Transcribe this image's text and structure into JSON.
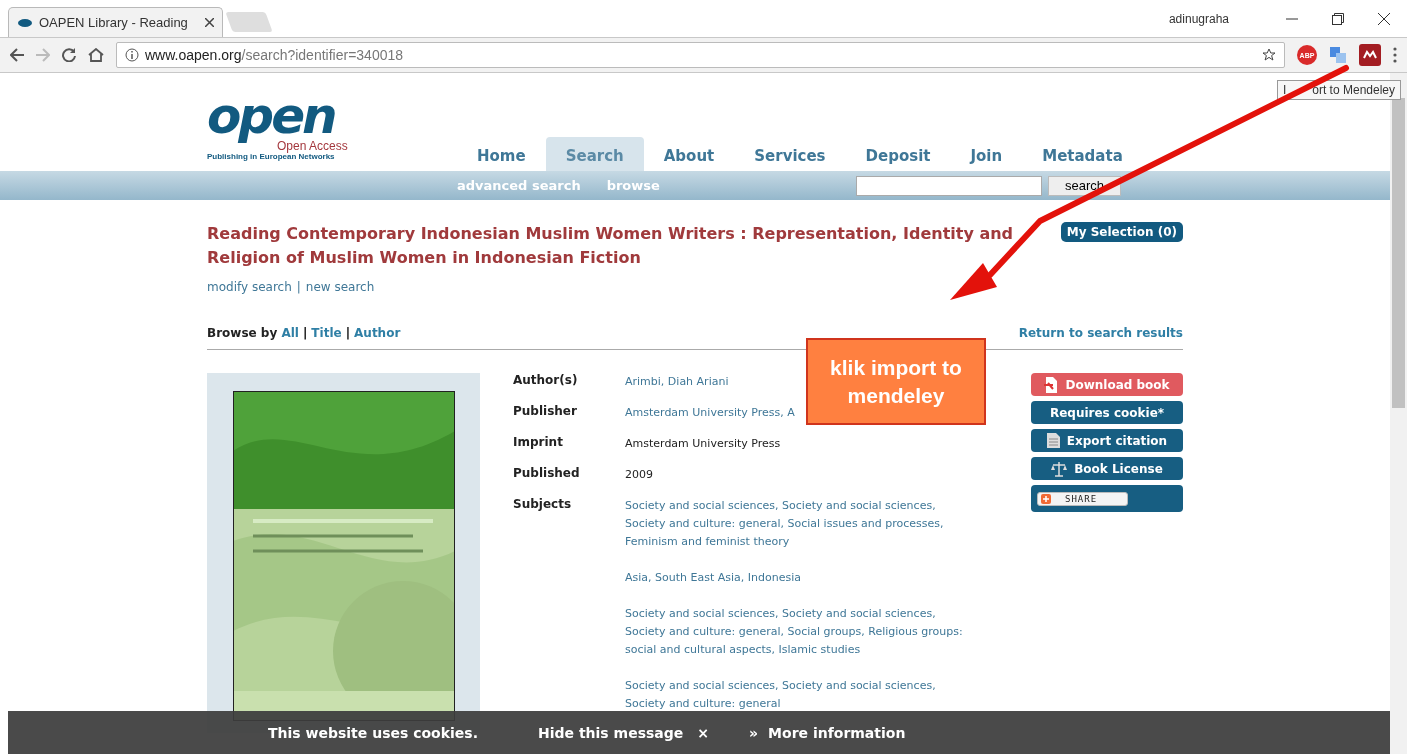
{
  "browser": {
    "tab_title": "OAPEN Library - Reading",
    "profile": "adinugraha",
    "url_host": "www.oapen.org",
    "url_path": "/search?identifier=340018",
    "adblock_label": "ABP",
    "tooltip": [
      "I",
      "ort to Mendeley"
    ]
  },
  "logo": {
    "word": "open",
    "tagline": "Open Access",
    "subtitle": "Publishing in European Networks"
  },
  "nav": [
    {
      "label": "Home",
      "selected": false
    },
    {
      "label": "Search",
      "selected": true
    },
    {
      "label": "About",
      "selected": false
    },
    {
      "label": "Services",
      "selected": false
    },
    {
      "label": "Deposit",
      "selected": false
    },
    {
      "label": "Join",
      "selected": false
    },
    {
      "label": "Metadata",
      "selected": false
    }
  ],
  "subnav": [
    "advanced search",
    "browse"
  ],
  "search_button": "search",
  "title": "Reading Contemporary Indonesian Muslim Women Writers : Representation, Identity and Religion of Muslim Women in Indonesian Fiction",
  "my_selection": "My Selection (0)",
  "search_links": [
    "modify search",
    "new search"
  ],
  "link_separator": "|",
  "browse": {
    "label": "Browse by",
    "links": [
      "All",
      "Title",
      "Author"
    ],
    "separator": "|",
    "return": "Return to search results"
  },
  "cover": {
    "kind": "picture"
  },
  "metadata": [
    {
      "label": "Author(s)",
      "values": [
        "Arimbi, Diah Ariani"
      ],
      "link": true
    },
    {
      "label": "Publisher",
      "values": [
        "Amsterdam University Press, A"
      ],
      "link": true
    },
    {
      "label": "Imprint",
      "values": [
        "Amsterdam University Press"
      ],
      "link": false
    },
    {
      "label": "Published",
      "values": [
        "2009"
      ],
      "link": false
    },
    {
      "label": "Subjects",
      "values": [
        "Society and social sciences, Society and social sciences, Society and culture: general, Social issues and processes, Feminism and feminist theory",
        "Asia, South East Asia, Indonesia",
        "Society and social sciences, Society and social sciences, Society and culture: general, Social groups, Religious groups: social and cultural aspects, Islamic studies",
        "Society and social sciences, Society and social sciences, Society and culture: general"
      ],
      "link": true
    }
  ],
  "actions": [
    {
      "label": "Download book",
      "kind": "download"
    },
    {
      "label": "Requires cookie*",
      "kind": "plain"
    },
    {
      "label": "Export citation",
      "kind": "citation"
    },
    {
      "label": "Book License",
      "kind": "license"
    },
    {
      "label": "SHARE",
      "kind": "share"
    }
  ],
  "callout": "klik import to mendeley",
  "cookie_bar": {
    "message": "This website uses cookies.",
    "hide": "Hide this message",
    "close": "×",
    "more_icon": "»",
    "more": "More information"
  }
}
